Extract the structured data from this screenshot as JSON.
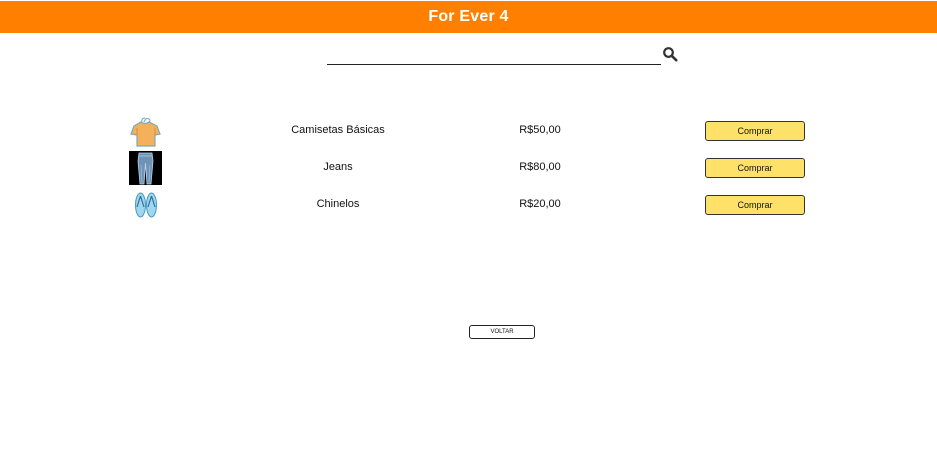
{
  "header": {
    "title": "For Ever 4"
  },
  "search": {
    "value": "",
    "placeholder": ""
  },
  "products": [
    {
      "image": "tshirt-image",
      "name": "Camisetas Básicas",
      "price": "R$50,00",
      "button": "Comprar"
    },
    {
      "image": "jeans-image",
      "name": "Jeans",
      "price": "R$80,00",
      "button": "Comprar"
    },
    {
      "image": "flip-flops-image",
      "name": "Chinelos",
      "price": "R$20,00",
      "button": "Comprar"
    }
  ],
  "back_button": "VOLTAR",
  "colors": {
    "header": "#ff8000",
    "buy_button": "#fde168"
  }
}
